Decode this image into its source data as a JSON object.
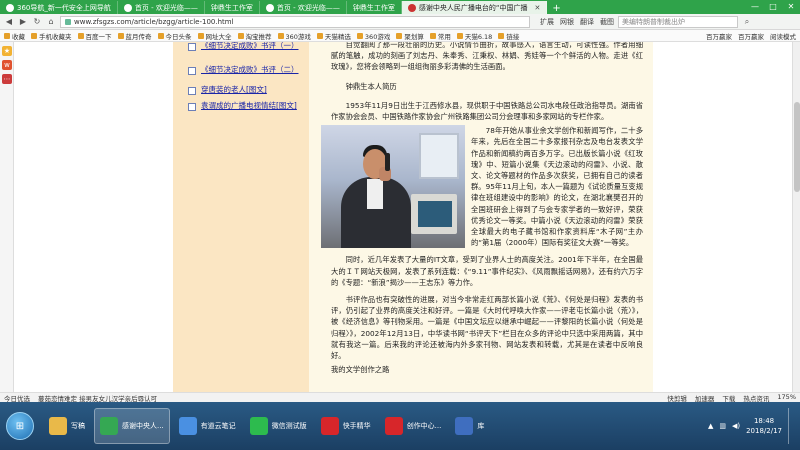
{
  "browser": {
    "tabs": [
      {
        "title": "360导航_新一代安全上网导航",
        "active": false
      },
      {
        "title": "首页 - 欢迎光临——",
        "active": false
      },
      {
        "title": "钟鼎生工作室",
        "active": false
      },
      {
        "title": "首页 - 欢迎光临——",
        "active": false
      },
      {
        "title": "钟鼎生工作室",
        "active": false
      },
      {
        "title": "感谢中央人民广播电台的“中国广播",
        "active": true
      }
    ],
    "new_tab": "+",
    "window_controls": [
      "—",
      "□",
      "✕"
    ],
    "url": "www.zfsgzs.com/article/bzgg/article-100.html",
    "right_tools": [
      "扩展",
      "网银",
      "翻译",
      "截图"
    ],
    "search_placeholder": "美编特朗普制裁出炉",
    "bookmarks": [
      "收藏",
      "手机收藏夹",
      "百度一下",
      "蓝月传奇",
      "今日头条",
      "网址大全",
      "淘宝推荐",
      "360游戏",
      "天猫精选",
      "360游戏",
      "聚划算",
      "常用",
      "天猫6.18",
      "链接"
    ],
    "bookmarks_right": [
      "百万赢家",
      "百万赢家",
      "阅读模式"
    ]
  },
  "sidebar": {
    "items": [
      "《细节决定成败》书评（一）",
      "《细节决定成败》书评（二）",
      "穿唐装的老人[图文]",
      "袁谓成的广播电视情结[图文]"
    ]
  },
  "article": {
    "intro": "自觉翻阅了那一段壮丽的历史。小说情节曲折，故事感人，语言生动，可读性强。作者用细腻的笔触，成功的刻画了刘志丹、朱奉秀、江秉权、林娟、秀娃等一个个鲜活的人物。走进《红玫瑰》，您将会领略到一组组徇丽多彩涛佛的生活画面。",
    "heading": "钟鼎生本人简历",
    "p1": "1953年11月9日出生于江西修水县，现供职于中国铁路总公司水电段任政治指导员。湖南省作家协会会员、中国铁路作家协会广州铁路集团公司分会理事和多家网站的专栏作家。",
    "p2": "78年开始从事业余文学创作和新闻写作，二十多年来，先后在全国二十多家报刊杂志及电台发表文学作品和新闻稿约两百多万字。已出版长篇小说《红玫瑰》中、短篇小说集《天边滚动的闷雷》、小说、散文、论文等题材的作品多次获奖，已拥有自己的读者群。95年11月上旬，本人一篇题为《试论质量互变规律在班组建设中的影响》的论文，在湖北襄樊召开的全国班研会上得到了与会专家学者的一致好评，荣获优秀论文一等奖。中篇小说《天边滚动的闷雷》荣获全球最大的电子藏书馆和作家资料库“木子网”主办的“第1届（2000年）国际有奖征文大赛”一等奖。",
    "p3": "同时，近几年发表了大量的IT文章，受到了业界人士的高度关注。2001年下半年，在全国最大的ＩＴ网站天极网，发表了系列连载：《“9.11”事件纪实》、《风雨飘摇话网易》，还有约六万字的《专题：“新浪”揭沙——王志东》等力作。",
    "p4": "书评作品也有突破性的进展，对当今非常走红两部长篇小说《荒》、《何处是归程》发表的书评，仍引起了业界的高度关注和好评。一篇是《大时代呼唤大作家——评老屯长篇小说〈荒〉》，被《经济信息》等刊物采用。一篇是《中国文坛应以继承中崛起——评黎阳的长篇小说〈何处是归程〉》，2002年12月13日，中华读书网“书评天下”栏目在众多的评论中只选中采用两篇，其中就有我这一篇。后来我的评论还被海内外多家刊物、网站发表和转载，尤其是在读者中反响良好。",
    "p5": "我的文学创作之路"
  },
  "status_bar": {
    "left": [
      "今日优选",
      "蔓茹恋情难定 接男友女儿汉学亲后辱认可"
    ],
    "right": [
      "快剪辑",
      "加速器",
      "下载",
      "热点资讯",
      "175%"
    ]
  },
  "taskbar": {
    "items": [
      {
        "label": "写稿",
        "active": false
      },
      {
        "label": "感谢中央人...",
        "active": true
      },
      {
        "label": "有道云笔记",
        "active": false
      },
      {
        "label": "微信测试版",
        "active": false
      },
      {
        "label": "快手精华",
        "active": false
      },
      {
        "label": "创作中心...",
        "active": false
      },
      {
        "label": "库",
        "active": false
      }
    ],
    "time": "18:48",
    "date": "2018/2/17"
  },
  "colors": {
    "tabbar": "#2fa34a",
    "sidebar_bg": "#fbe6c3",
    "article_bg": "#fdf8e6",
    "link": "#1a25a8",
    "taskbar": "#1b3f63"
  }
}
